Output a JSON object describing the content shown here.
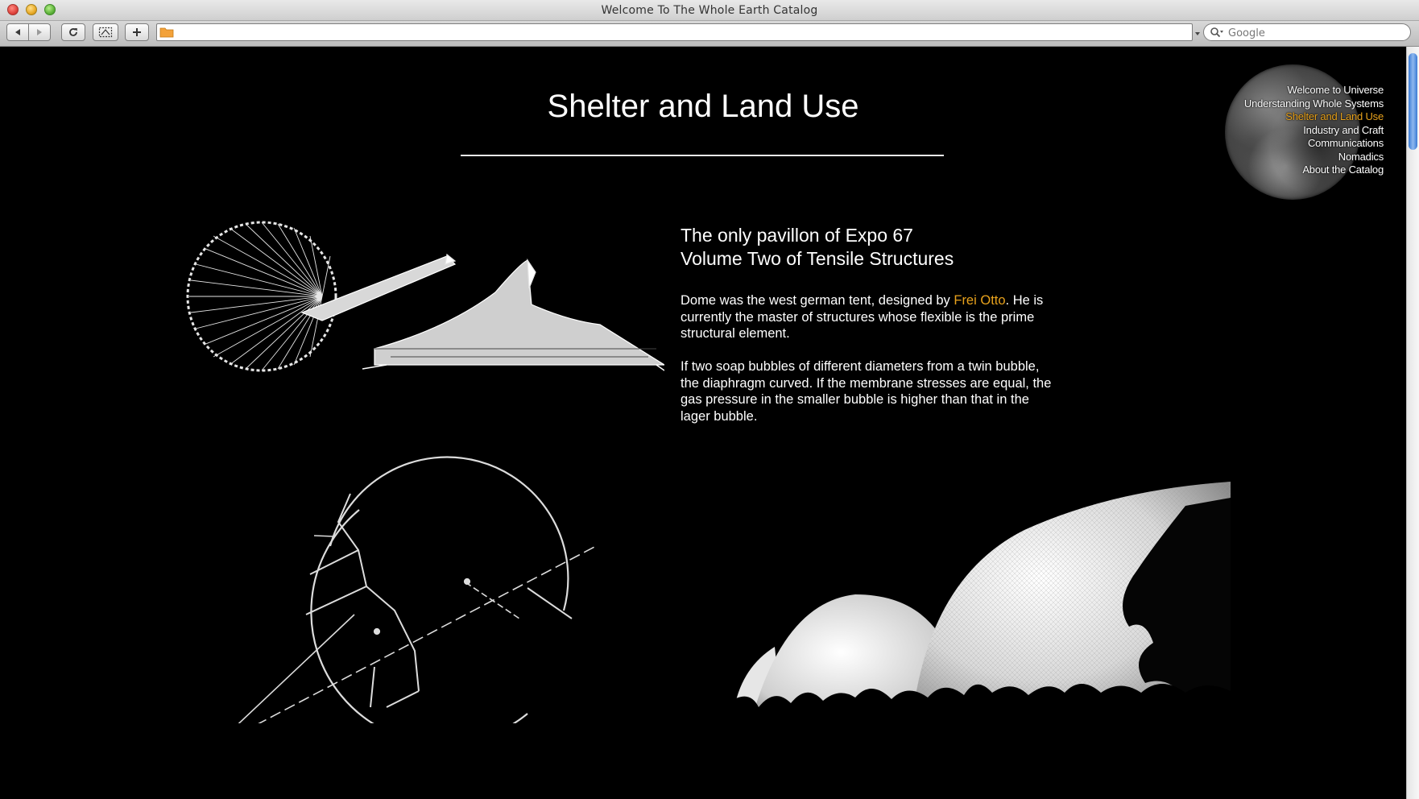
{
  "window": {
    "title": "Welcome To The Whole Earth Catalog"
  },
  "toolbar": {
    "address_value": "",
    "search_placeholder": "Google"
  },
  "page": {
    "title": "Shelter and Land Use",
    "headline_line1": "The only pavillon of Expo 67",
    "headline_line2": "Volume Two of Tensile Structures",
    "para1_before_link": "Dome was the west german tent, designed by ",
    "para1_link": "Frei Otto",
    "para1_after_link": ". He is currently the master of structures whose flexible is the prime structural element.",
    "para2": "If two soap bubbles of different diameters from a twin bubble, the diaphragm curved. If the membrane stresses are equal, the gas pressure in the smaller bubble is higher than that in the lager bubble."
  },
  "nav": {
    "items": [
      {
        "label": "Welcome to Universe"
      },
      {
        "label": "Understanding Whole Systems"
      },
      {
        "label": "Shelter and Land Use"
      },
      {
        "label": "Industry and Craft"
      },
      {
        "label": "Communications"
      },
      {
        "label": "Nomadics"
      },
      {
        "label": "About the Catalog"
      }
    ],
    "active_index": 2
  },
  "colors": {
    "background": "#000000",
    "text": "#ffffff",
    "accent": "#e8a21c"
  },
  "icons": [
    "back-arrow-icon",
    "forward-arrow-icon",
    "reload-icon",
    "snippet-icon",
    "plus-icon",
    "folder-icon",
    "magnifier-icon"
  ]
}
